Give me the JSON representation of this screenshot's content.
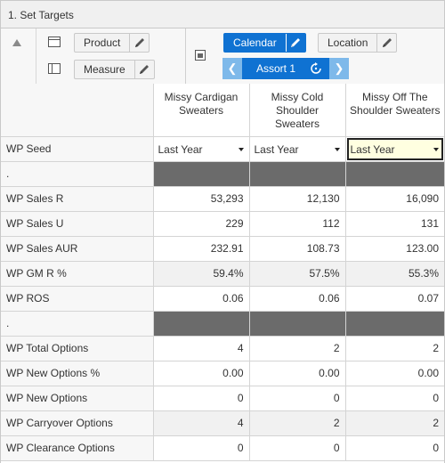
{
  "window": {
    "title": "1. Set Targets"
  },
  "toolbar": {
    "product_label": "Product",
    "measure_label": "Measure",
    "calendar_label": "Calendar",
    "location_label": "Location",
    "assortment_label": "Assort 1",
    "prev_arrow": "❮",
    "next_arrow": "❯",
    "active_color": "#0f72d2"
  },
  "grid": {
    "columns": [
      "Missy Cardigan Sweaters",
      "Missy Cold Shoulder Sweaters",
      "Missy Off The Shoulder Sweaters"
    ],
    "seed_row": {
      "label": "WP Seed",
      "values": [
        "Last Year",
        "Last Year",
        "Last Year"
      ]
    },
    "separator_label": ".",
    "sales_rows": [
      {
        "label": "WP Sales R",
        "values": [
          "53,293",
          "12,130",
          "16,090"
        ]
      },
      {
        "label": "WP Sales U",
        "values": [
          "229",
          "112",
          "131"
        ]
      },
      {
        "label": "WP Sales AUR",
        "values": [
          "232.91",
          "108.73",
          "123.00"
        ]
      },
      {
        "label": "WP GM R %",
        "values": [
          "59.4%",
          "57.5%",
          "55.3%"
        ]
      },
      {
        "label": "WP ROS",
        "values": [
          "0.06",
          "0.06",
          "0.07"
        ]
      }
    ],
    "option_rows": [
      {
        "label": "WP Total Options",
        "values": [
          "4",
          "2",
          "2"
        ]
      },
      {
        "label": "WP New Options %",
        "values": [
          "0.00",
          "0.00",
          "0.00"
        ]
      },
      {
        "label": "WP New Options",
        "values": [
          "0",
          "0",
          "0"
        ]
      },
      {
        "label": "WP Carryover Options",
        "values": [
          "4",
          "2",
          "2"
        ]
      },
      {
        "label": "WP Clearance Options",
        "values": [
          "0",
          "0",
          "0"
        ]
      }
    ]
  }
}
